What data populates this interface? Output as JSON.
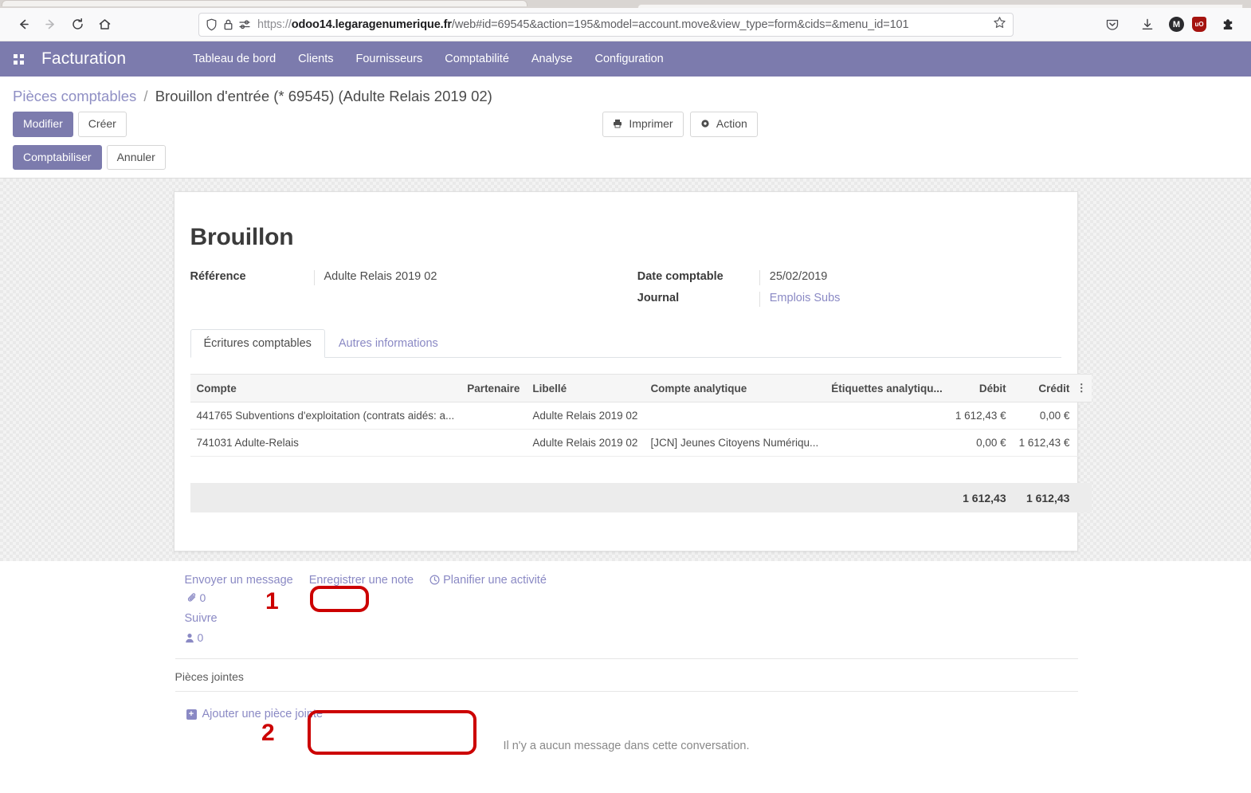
{
  "browser": {
    "url_prefix": "https://",
    "url_domain": "odoo14.legaragenumerique.fr",
    "url_path": "/web#id=69545&action=195&model=account.move&view_type=form&cids=&menu_id=101",
    "back_title": "Back",
    "forward_title": "Forward",
    "reload_title": "Reload",
    "home_title": "Home",
    "shield_icon": "shield-icon",
    "lock_icon": "lock-icon",
    "permissions_icon": "permissions-icon",
    "bookmark_icon": "bookmark-star-icon",
    "pocket_icon": "pocket-icon",
    "downloads_icon": "downloads-icon",
    "account_initial": "M",
    "ublock_label": "uO"
  },
  "odoo_navbar": {
    "apps_icon": "apps-grid-icon",
    "app_title": "Facturation",
    "menu_items": [
      {
        "label": "Tableau de bord"
      },
      {
        "label": "Clients"
      },
      {
        "label": "Fournisseurs"
      },
      {
        "label": "Comptabilité"
      },
      {
        "label": "Analyse"
      },
      {
        "label": "Configuration"
      }
    ]
  },
  "control_panel": {
    "breadcrumb_root": "Pièces comptables",
    "breadcrumb_separator": "/",
    "breadcrumb_current": "Brouillon d'entrée (* 69545) (Adulte Relais 2019 02)",
    "buttons_primary_row": [
      {
        "label": "Modifier",
        "style": "primary"
      },
      {
        "label": "Créer",
        "style": "default"
      }
    ],
    "buttons_right": [
      {
        "label": "Imprimer",
        "icon": "printer-icon"
      },
      {
        "label": "Action",
        "icon": "gear-icon"
      }
    ],
    "buttons_secondary_row": [
      {
        "label": "Comptabiliser",
        "style": "primary"
      },
      {
        "label": "Annuler",
        "style": "default"
      }
    ]
  },
  "form": {
    "status_title": "Brouillon",
    "fields_left": [
      {
        "label": "Référence",
        "value": "Adulte Relais 2019 02",
        "is_link": false
      }
    ],
    "fields_right": [
      {
        "label": "Date comptable",
        "value": "25/02/2019",
        "is_link": false
      },
      {
        "label": "Journal",
        "value": "Emplois Subs",
        "is_link": true
      }
    ],
    "tabs": [
      {
        "label": "Écritures comptables",
        "active": true
      },
      {
        "label": "Autres informations",
        "active": false
      }
    ],
    "table": {
      "columns": [
        "Compte",
        "Partenaire",
        "Libellé",
        "Compte analytique",
        "Étiquettes analytiqu...",
        "Débit",
        "Crédit"
      ],
      "optional_columns_icon": "kebab-menu-icon",
      "rows": [
        {
          "compte": "441765 Subventions d'exploitation (contrats aidés: a...",
          "partenaire": "",
          "libelle": "Adulte Relais 2019 02",
          "analytique": "",
          "etiquettes": "",
          "debit": "1 612,43 €",
          "credit": "0,00 €"
        },
        {
          "compte": "741031 Adulte-Relais",
          "partenaire": "",
          "libelle": "Adulte Relais 2019 02",
          "analytique": "[JCN] Jeunes Citoyens Numériqu...",
          "etiquettes": "",
          "debit": "0,00 €",
          "credit": "1 612,43 €"
        }
      ],
      "totals": {
        "debit": "1 612,43",
        "credit": "1 612,43"
      }
    }
  },
  "chatter": {
    "actions": [
      {
        "label": "Envoyer un message",
        "icon": ""
      },
      {
        "label": "Enregistrer une note",
        "icon": ""
      },
      {
        "label": "Planifier une activité",
        "icon": "clock-icon"
      }
    ],
    "attachment_icon": "paperclip-icon",
    "attachment_count": "0",
    "follow_label": "Suivre",
    "followers_icon": "user-icon",
    "followers_count": "0",
    "attachments_label": "Pièces jointes",
    "add_attachment_label": "Ajouter une pièce jointe",
    "add_attachment_icon": "plus-square-icon",
    "empty_thread_message": "Il n'y a aucun message dans cette conversation."
  },
  "annotations": [
    {
      "number": "1",
      "target": "attachment-count-button"
    },
    {
      "number": "2",
      "target": "add-attachment-button"
    }
  ],
  "colors": {
    "odoo_purple": "#7c7bad",
    "link_purple": "#8a89c4",
    "annotation_red": "#cc0000"
  }
}
